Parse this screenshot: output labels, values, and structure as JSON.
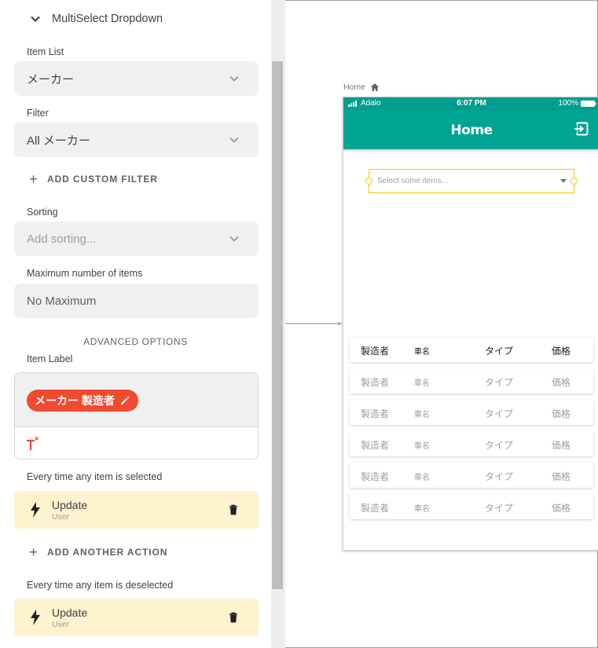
{
  "panel": {
    "section_title": "MultiSelect Dropdown",
    "item_list": {
      "label": "Item List",
      "value": "メーカー"
    },
    "filter": {
      "label": "Filter",
      "value": "All メーカー"
    },
    "add_custom_filter": "ADD CUSTOM FILTER",
    "sorting": {
      "label": "Sorting",
      "placeholder": "Add sorting..."
    },
    "max_items": {
      "label": "Maximum number of items",
      "value": "No Maximum"
    },
    "advanced_options": "ADVANCED OPTIONS",
    "item_label": {
      "label": "Item Label",
      "chip": "メーカー 製造者"
    },
    "on_select": {
      "label": "Every time any item is selected",
      "action_title": "Update",
      "action_sub": "User"
    },
    "add_another_action": "ADD ANOTHER ACTION",
    "on_deselect": {
      "label": "Every time any item is deselected",
      "action_title": "Update",
      "action_sub": "User"
    }
  },
  "canvas": {
    "screen_name": "Home",
    "status": {
      "carrier": "Adalo",
      "time": "6:07 PM",
      "battery": "100%"
    },
    "appbar_title": "Home",
    "dropdown_placeholder": "Select some items...",
    "table_header": {
      "c1": "製造者",
      "c2": "車名",
      "c3": "タイプ",
      "c4": "価格"
    },
    "rows": [
      {
        "c1": "製造者",
        "c2": "車名",
        "c3": "タイプ",
        "c4": "価格"
      },
      {
        "c1": "製造者",
        "c2": "車名",
        "c3": "タイプ",
        "c4": "価格"
      },
      {
        "c1": "製造者",
        "c2": "車名",
        "c3": "タイプ",
        "c4": "価格"
      },
      {
        "c1": "製造者",
        "c2": "車名",
        "c3": "タイプ",
        "c4": "価格"
      },
      {
        "c1": "製造者",
        "c2": "車名",
        "c3": "タイプ",
        "c4": "価格"
      }
    ]
  },
  "colors": {
    "teal": "#00a493",
    "chip": "#f04b30",
    "action_bg": "#fff2cf",
    "selection": "#ffc107"
  }
}
